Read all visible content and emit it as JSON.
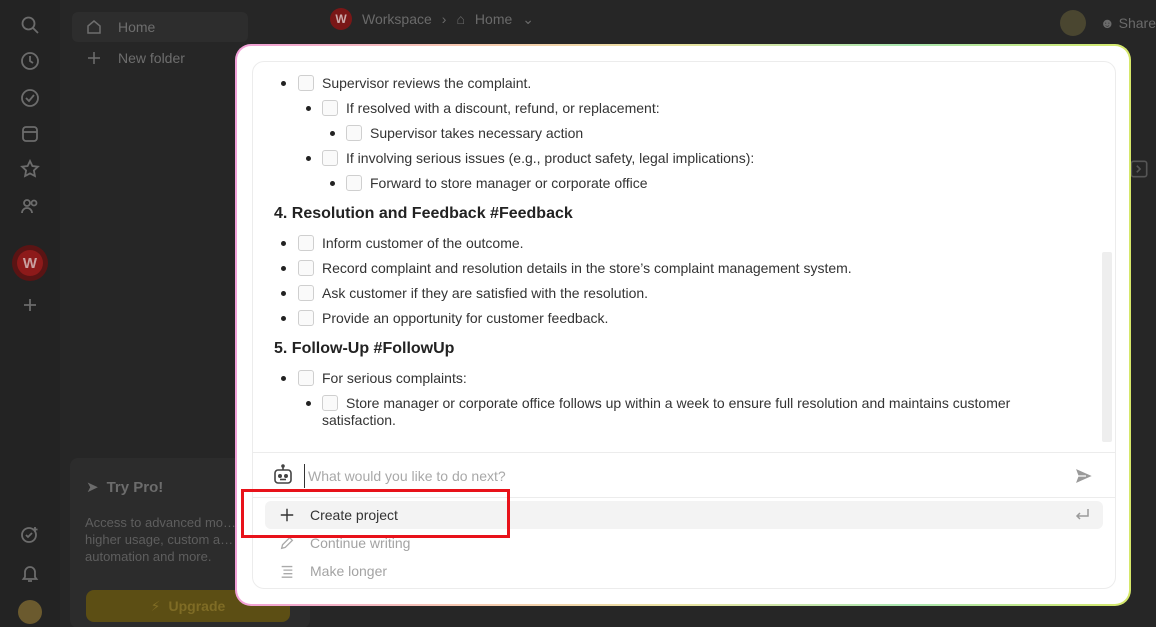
{
  "background": {
    "sidebar": {
      "home_label": "Home",
      "new_folder_label": "New folder"
    },
    "topbar": {
      "workspace_label": "Workspace",
      "home_label": "Home",
      "share_label": "Share",
      "workspace_logo_letter": "W"
    },
    "rail": {
      "workspace_letter": "W",
      "icons": [
        "search-icon",
        "clock-icon",
        "check-circle-icon",
        "database-icon",
        "star-icon",
        "users-icon",
        "plus-icon",
        "check-plus-icon",
        "bell-icon"
      ]
    },
    "try_pro": {
      "title": "Try Pro!",
      "text": "Access to advanced mo… higher usage, custom a… automation and more.",
      "upgrade_label": "Upgrade"
    }
  },
  "document": {
    "items": [
      {
        "level": 1,
        "text": "Supervisor reviews the complaint."
      },
      {
        "level": 2,
        "text": "If resolved with a discount, refund, or replacement:"
      },
      {
        "level": 3,
        "text": "Supervisor takes necessary action"
      },
      {
        "level": 2,
        "text": "If involving serious issues (e.g., product safety, legal implications):"
      },
      {
        "level": 3,
        "text": "Forward to store manager or corporate office"
      }
    ],
    "section4": {
      "heading": "4. Resolution and Feedback #Feedback",
      "items": [
        "Inform customer of the outcome.",
        "Record complaint and resolution details in the store’s complaint management system.",
        "Ask customer if they are satisfied with the resolution.",
        "Provide an opportunity for customer feedback."
      ]
    },
    "section5": {
      "heading": "5. Follow-Up #FollowUp",
      "item": "For serious complaints:",
      "sub_item_line1": "Store manager or corporate office follows up within a week to ensure full resolution and maintains customer",
      "sub_item_line2": "satisfaction."
    }
  },
  "prompt": {
    "placeholder": "What would you like to do next?",
    "value": ""
  },
  "actions": [
    {
      "label": "Create project",
      "icon": "plus-icon",
      "active": true
    },
    {
      "label": "Continue writing",
      "icon": "pencil-icon",
      "active": false
    },
    {
      "label": "Make longer",
      "icon": "lines-icon",
      "active": false
    }
  ],
  "colors": {
    "highlight": "#e8121a",
    "brand": "#8d1a1a"
  }
}
